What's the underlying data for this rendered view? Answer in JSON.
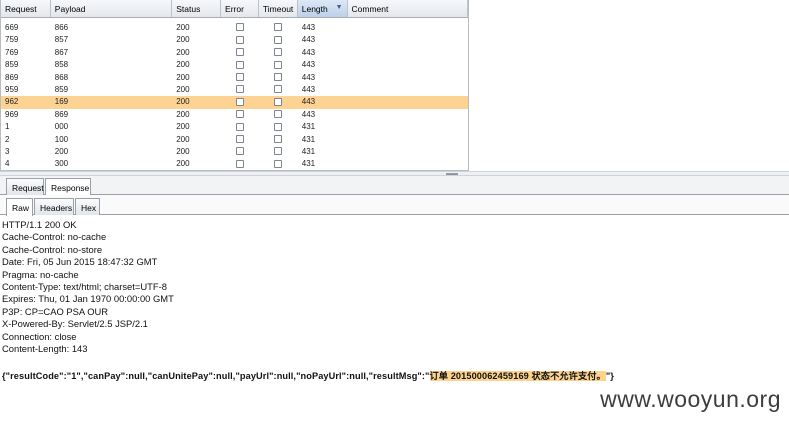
{
  "table": {
    "columns": [
      "Request",
      "Payload",
      "Status",
      "Error",
      "Timeout",
      "Length",
      "Comment"
    ],
    "sorted_column": "Length",
    "partial_top_row": {
      "request": "",
      "payload": "",
      "status": "",
      "length": "443"
    },
    "rows": [
      {
        "request": "669",
        "payload": "866",
        "status": "200",
        "length": "443",
        "selected": false
      },
      {
        "request": "759",
        "payload": "857",
        "status": "200",
        "length": "443",
        "selected": false
      },
      {
        "request": "769",
        "payload": "867",
        "status": "200",
        "length": "443",
        "selected": false
      },
      {
        "request": "859",
        "payload": "858",
        "status": "200",
        "length": "443",
        "selected": false
      },
      {
        "request": "869",
        "payload": "868",
        "status": "200",
        "length": "443",
        "selected": false
      },
      {
        "request": "959",
        "payload": "859",
        "status": "200",
        "length": "443",
        "selected": false
      },
      {
        "request": "962",
        "payload": "169",
        "status": "200",
        "length": "443",
        "selected": true
      },
      {
        "request": "969",
        "payload": "869",
        "status": "200",
        "length": "443",
        "selected": false
      },
      {
        "request": "1",
        "payload": "000",
        "status": "200",
        "length": "431",
        "selected": false
      },
      {
        "request": "2",
        "payload": "100",
        "status": "200",
        "length": "431",
        "selected": false
      },
      {
        "request": "3",
        "payload": "200",
        "status": "200",
        "length": "431",
        "selected": false
      },
      {
        "request": "4",
        "payload": "300",
        "status": "200",
        "length": "431",
        "selected": false
      }
    ],
    "selected_color": "#fdd393"
  },
  "tabs": {
    "request": "Request",
    "response": "Response",
    "active": "Response"
  },
  "subtabs": {
    "raw": "Raw",
    "headers": "Headers",
    "hex": "Hex",
    "active": "Raw"
  },
  "response": {
    "header_lines": [
      "HTTP/1.1 200 OK",
      "Cache-Control: no-cache",
      "Cache-Control: no-store",
      "Date: Fri, 05 Jun 2015 18:47:32 GMT",
      "Pragma: no-cache",
      "Content-Type: text/html; charset=UTF-8",
      "Expires: Thu, 01 Jan 1970 00:00:00 GMT",
      "P3P: CP=CAO PSA OUR",
      "X-Powered-By: Servlet/2.5 JSP/2.1",
      "Connection: close",
      "Content-Length: 143"
    ],
    "body_prefix": "{\"resultCode\":\"1\",\"canPay\":null,\"canUnitePay\":null,\"payUrl\":null,\"noPayUrl\":null,\"resultMsg\":\"",
    "body_highlight": "订单 201500062459169 状态不允许支付。",
    "body_suffix": "\"}",
    "highlight_color": "#fdd28b"
  },
  "watermark": "www.wooyun.org"
}
